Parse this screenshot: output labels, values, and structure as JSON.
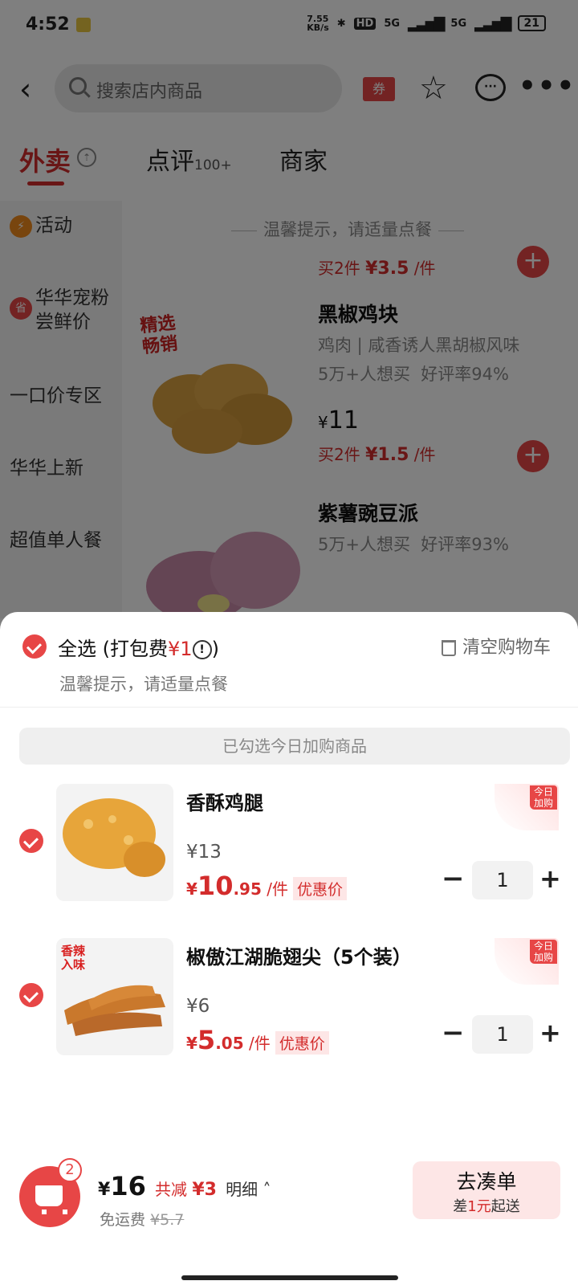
{
  "status_bar": {
    "time": "4:52",
    "net_speed": "7.55\nKB/s",
    "hd": "HD",
    "sig1": "5G",
    "sig2": "5G",
    "battery": "21"
  },
  "header": {
    "search_placeholder": "搜索店内商品",
    "coupon_label": "券"
  },
  "tabs": [
    {
      "label": "外卖"
    },
    {
      "label": "点评",
      "sub": "100+"
    },
    {
      "label": "商家"
    }
  ],
  "sidebar": {
    "items": [
      {
        "label": "活动",
        "badge": "⚡"
      },
      {
        "label": "华华宠粉\n尝鲜价",
        "badge": "省"
      },
      {
        "label": "一口价专区"
      },
      {
        "label": "华华上新"
      },
      {
        "label": "超值单人餐"
      }
    ]
  },
  "menu": {
    "tip": "温馨提示，请适量点餐",
    "partial_deal": "买2件",
    "partial_deal_price": "¥3.5",
    "partial_deal_unit": "/件",
    "products": [
      {
        "name": "黑椒鸡块",
        "tag": "精选\n畅销",
        "desc": "鸡肉 | 咸香诱人黑胡椒风味",
        "stats": "5万+人想买  好评率94%",
        "price_cur": "¥",
        "price": "11",
        "deal_prefix": "买2件",
        "deal_price": "¥1.5",
        "deal_unit": "/件"
      },
      {
        "name": "紫薯豌豆派",
        "stats": "5万+人想买  好评率93%"
      }
    ]
  },
  "cart": {
    "select_all": "全选",
    "pack_fee_prefix": "(打包费",
    "pack_fee": "¥1",
    "pack_fee_suffix": ")",
    "clear": "清空购物车",
    "tip": "温馨提示，请适量点餐",
    "banner": "已勾选今日加购商品",
    "corner_tag": "今日\n加购",
    "items": [
      {
        "name": "香酥鸡腿",
        "orig_price": "¥13",
        "deal_cur": "¥",
        "deal_int": "10",
        "deal_dec": ".95",
        "deal_unit": "/件",
        "deal_label": "优惠价",
        "qty": "1"
      },
      {
        "name": "椒傲江湖脆翅尖（5个装）",
        "tag": "香辣\n入味",
        "orig_price": "¥6",
        "deal_cur": "¥",
        "deal_int": "5",
        "deal_dec": ".05",
        "deal_unit": "/件",
        "deal_label": "优惠价",
        "qty": "1"
      }
    ],
    "footer": {
      "count": "2",
      "total_cur": "¥",
      "total": "16",
      "save_prefix": "共减",
      "save": "¥3",
      "detail": "明细",
      "delivery_prefix": "免运费",
      "delivery_orig": "¥5.7",
      "go_label": "去凑单",
      "min_prefix": "差",
      "min_amount": "1元",
      "min_suffix": "起送"
    }
  },
  "colors": {
    "accent": "#e74646",
    "price_red": "#d32c2c",
    "overlay": "rgba(0,0,0,0.5)"
  }
}
